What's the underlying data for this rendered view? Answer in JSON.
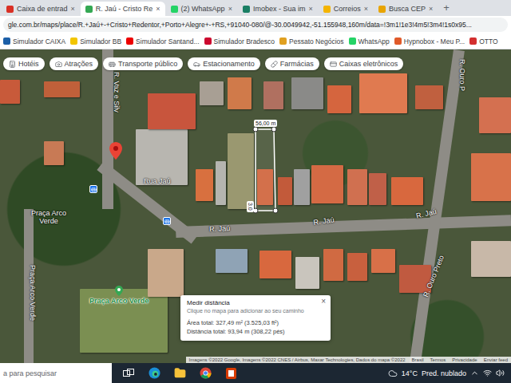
{
  "browser": {
    "tabs": [
      {
        "label": "Caixa de entrad",
        "selected": false,
        "color": "#d93025"
      },
      {
        "label": "R. Jaú - Cristo Re",
        "selected": true,
        "color": "#34a853"
      },
      {
        "label": "(2) WhatsApp",
        "selected": false,
        "color": "#25d366"
      },
      {
        "label": "Imobex - Sua im",
        "selected": false,
        "color": "#1a7f64"
      },
      {
        "label": "Correios",
        "selected": false,
        "color": "#f4b400"
      },
      {
        "label": "Busca CEP",
        "selected": false,
        "color": "#e8a400"
      }
    ],
    "tab_close": "×",
    "new_tab": "+",
    "address": "gle.com.br/maps/place/R.+Jaú+-+Cristo+Redentor,+Porto+Alegre+-+RS,+91040-080/@-30.0049942,-51.155948,160m/data=!3m1!1e3!4m5!3m4!1s0x95...",
    "bookmarks": [
      {
        "label": "Simulador CAIXA",
        "color": "#1c5fa8"
      },
      {
        "label": "Simulador BB",
        "color": "#f2c500"
      },
      {
        "label": "Simulador Santand...",
        "color": "#ec0000"
      },
      {
        "label": "Simulador Bradesco",
        "color": "#cc092f"
      },
      {
        "label": "Pessato Negócios",
        "color": "#e0a020"
      },
      {
        "label": "WhatsApp",
        "color": "#25d366"
      },
      {
        "label": "Hypnobox - Meu P...",
        "color": "#e05a2a"
      },
      {
        "label": "OTTO",
        "color": "#d32f2f"
      }
    ]
  },
  "map": {
    "chips": [
      "Hotéis",
      "Atrações",
      "Transporte público",
      "Estacionamento",
      "Farmácias",
      "Caixas eletrônicos"
    ],
    "labels": [
      {
        "text": "R. Vaz e Silv",
        "kind": "street"
      },
      {
        "text": "Rua Jaú",
        "kind": "street"
      },
      {
        "text": "R. Jaú",
        "kind": "street"
      },
      {
        "text": "R. Jaú",
        "kind": "street"
      },
      {
        "text": "R. Jaú",
        "kind": "street"
      },
      {
        "text": "R. Ouro Preto",
        "kind": "street"
      },
      {
        "text": "R. Ouro P",
        "kind": "street"
      },
      {
        "text": "Praça Arco Verde",
        "kind": "place"
      },
      {
        "text": "Praça Arco Verde",
        "kind": "street"
      },
      {
        "text": "Praça Arco Verde",
        "kind": "poi"
      }
    ],
    "measurement": {
      "segment": "56,00 m",
      "side": "3,0"
    },
    "popup": {
      "title": "Medir distância",
      "close": "×",
      "hint": "Clique no mapa para adicionar ao seu caminho",
      "area": "Área total: 327,49 m² (3.525,03 ft²)",
      "distance": "Distância total: 93,94 m (308,22 pés)"
    },
    "footer": [
      "Imagens ©2022 Google, Imagens ©2022 CNES / Airbus, Maxar Technologies, Dados do mapa ©2022",
      "Brasil",
      "Termos",
      "Privacidade",
      "Enviar feed"
    ]
  },
  "taskbar": {
    "search": {
      "placeholder": "a para pesquisar"
    },
    "weather": {
      "temperature": "14°C",
      "condition": "Pred. nublado"
    }
  }
}
